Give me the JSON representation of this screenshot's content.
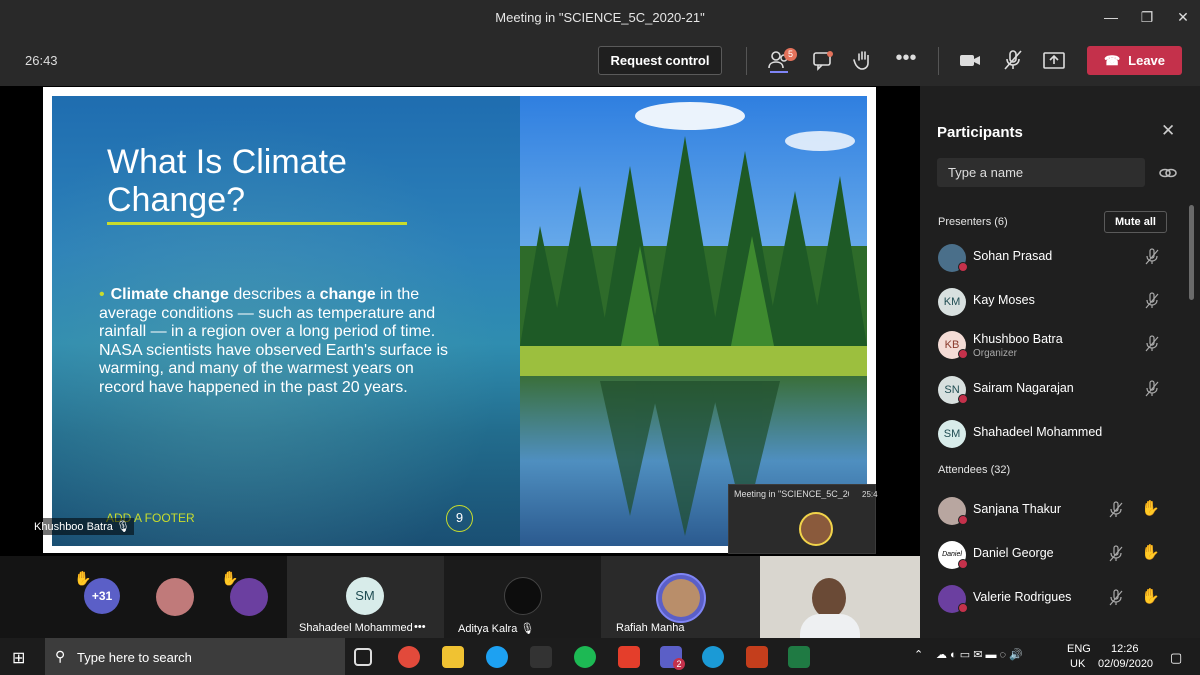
{
  "window": {
    "title": "Meeting in \"SCIENCE_5C_2020-21\""
  },
  "toolbar": {
    "timer": "26:43",
    "request_control": "Request control",
    "participants_badge": "5",
    "leave": "Leave"
  },
  "slide": {
    "title_line1": "What Is Climate",
    "title_line2": "Change?",
    "bullet_bold1": "Climate change",
    "bullet_text1": " describes a ",
    "bullet_bold2": "change",
    "bullet_text2": " in the average conditions — such as temperature and rainfall — in a region over a long period of time. NASA scientists have observed Earth's surface is warming, and many of the warmest years on record have happened in the past 20 years.",
    "footer": "ADD A FOOTER",
    "page": "9"
  },
  "presenter_label": "Khushboo Batra",
  "mini_window": {
    "title": "Meeting in \"SCIENCE_5C_20...",
    "time": "25:4"
  },
  "participants": {
    "title": "Participants",
    "search_placeholder": "Type a name",
    "presenters_header": "Presenters (6)",
    "mute_all": "Mute all",
    "presenters": [
      {
        "initials": "",
        "name": "Sohan Prasad",
        "sub": ""
      },
      {
        "initials": "KM",
        "name": "Kay Moses",
        "sub": ""
      },
      {
        "initials": "KB",
        "name": "Khushboo Batra",
        "sub": "Organizer"
      },
      {
        "initials": "SN",
        "name": "Sairam Nagarajan",
        "sub": ""
      },
      {
        "initials": "SM",
        "name": "Shahadeel Mohammed",
        "sub": ""
      }
    ],
    "attendees_header": "Attendees (32)",
    "attendees": [
      {
        "name": "Sanjana Thakur"
      },
      {
        "name": "Daniel George",
        "avatar_text": "Daniel"
      },
      {
        "name": "Valerie Rodrigues"
      }
    ]
  },
  "gallery": {
    "more_count": "+31",
    "tiles": [
      {
        "initials": "SM",
        "name": "Shahadeel Mohammed",
        "more": "•••"
      },
      {
        "name": "Aditya Kalra"
      },
      {
        "name": "Rafiah Manha"
      }
    ]
  },
  "taskbar": {
    "search_placeholder": "Type here to search",
    "lang1": "ENG",
    "lang2": "UK",
    "time": "12:26",
    "date": "02/09/2020",
    "teams_badge": "2"
  },
  "colors": {
    "leave": "#c4314b",
    "accent_lime": "#c8dc2d",
    "panel": "#1f1f1f",
    "titlebar": "#292929"
  }
}
